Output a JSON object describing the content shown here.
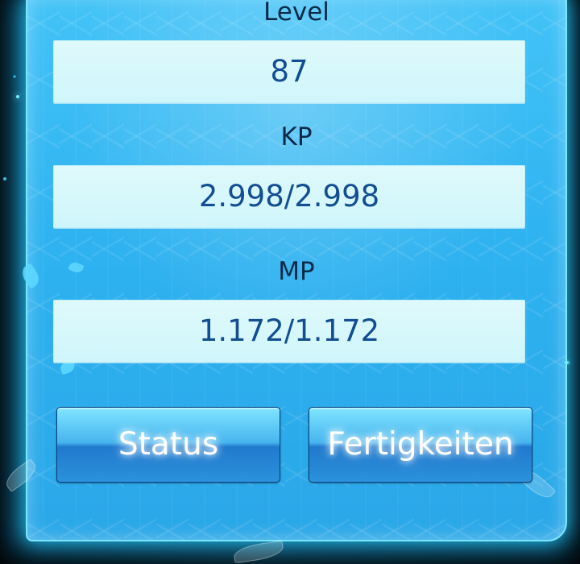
{
  "screen": {
    "level": {
      "label": "Level",
      "value": "87"
    },
    "kp": {
      "label": "KP",
      "value": "2.998/2.998"
    },
    "mp": {
      "label": "MP",
      "value": "1.172/1.172"
    },
    "buttons": {
      "status": "Status",
      "skills": "Fertigkeiten"
    }
  },
  "colors": {
    "panel": "#2eb2f0",
    "value_box": "#d6f8fb",
    "label_text": "#0b2948",
    "value_text": "#134e92",
    "button_top": "#7fe5ff",
    "button_bottom": "#2179cd"
  }
}
